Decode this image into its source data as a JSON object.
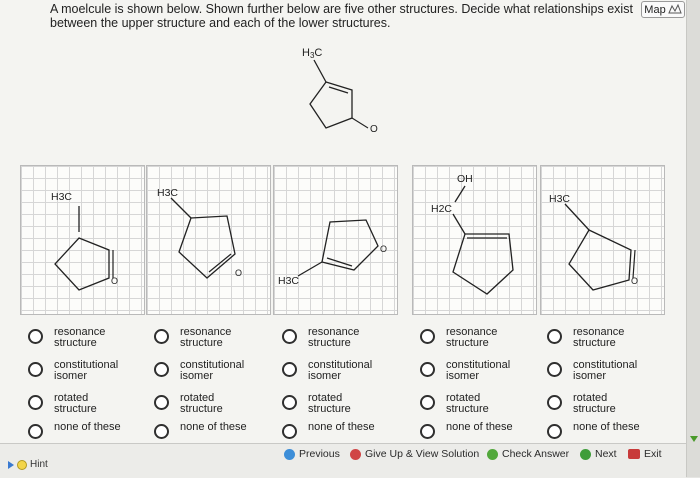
{
  "question": {
    "text": "A moelcule is shown below. Shown further below are five other structures. Decide what relationships exist between the upper structure and each of the lower structures."
  },
  "map_button": {
    "label": "Map",
    "icon": "map-icon"
  },
  "upper_structure": {
    "substituent": "H3C",
    "atom": "O"
  },
  "panels": [
    {
      "labels": [
        "H3C",
        "O"
      ]
    },
    {
      "labels": [
        "H3C",
        "O"
      ]
    },
    {
      "labels": [
        "H3C",
        "O"
      ]
    },
    {
      "labels": [
        "OH",
        "H2C"
      ]
    },
    {
      "labels": [
        "H3C",
        "O"
      ]
    }
  ],
  "options": [
    "resonance structure",
    "constitutional isomer",
    "rotated structure",
    "none of these"
  ],
  "footer": {
    "hint": "Hint",
    "previous": "Previous",
    "give_up": "Give Up & View Solution",
    "check": "Check Answer",
    "next": "Next",
    "exit": "Exit"
  }
}
